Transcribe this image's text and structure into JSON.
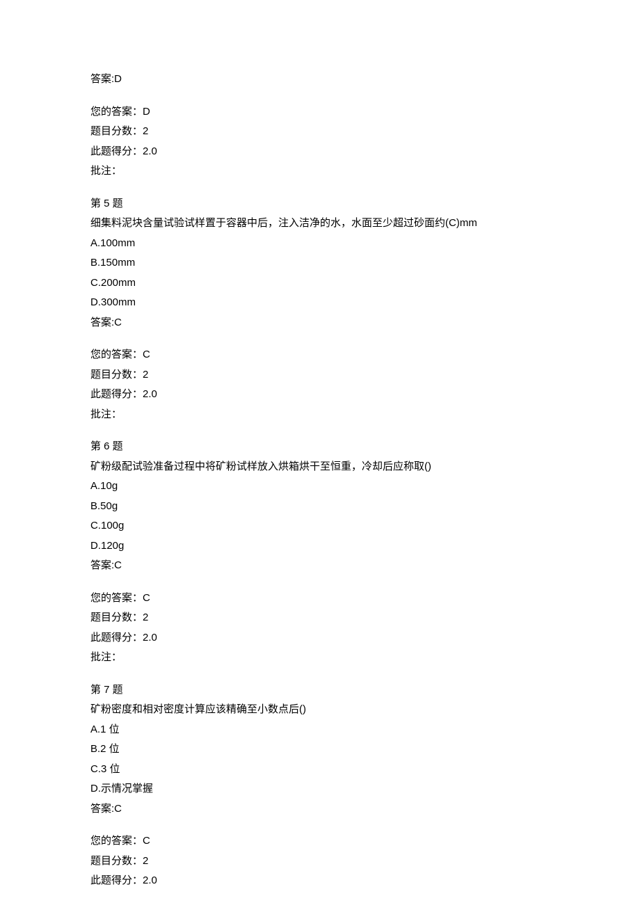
{
  "prev_answer_tail": {
    "answer_label": "答案:D",
    "your_answer_label": "您的答案：D",
    "score_label": "题目分数：2",
    "obtained_label": "此题得分：2.0",
    "remark_label": "批注："
  },
  "questions": [
    {
      "number_label": "第 5 题",
      "stem": "细集料泥块含量试验试样置于容器中后，注入洁净的水，水面至少超过砂面约(C)mm",
      "options": {
        "A": "A.100mm",
        "B": "B.150mm",
        "C": "C.200mm",
        "D": "D.300mm"
      },
      "answer_label": "答案:C",
      "your_answer_label": "您的答案：C",
      "score_label": "题目分数：2",
      "obtained_label": "此题得分：2.0",
      "remark_label": "批注："
    },
    {
      "number_label": "第 6 题",
      "stem": "矿粉级配试验准备过程中将矿粉试样放入烘箱烘干至恒重，冷却后应称取()",
      "options": {
        "A": "A.10g",
        "B": "B.50g",
        "C": "C.100g",
        "D": "D.120g"
      },
      "answer_label": "答案:C",
      "your_answer_label": "您的答案：C",
      "score_label": "题目分数：2",
      "obtained_label": "此题得分：2.0",
      "remark_label": "批注："
    },
    {
      "number_label": "第 7 题",
      "stem": "矿粉密度和相对密度计算应该精确至小数点后()",
      "options": {
        "A": "A.1 位",
        "B": "B.2 位",
        "C": "C.3 位",
        "D": "D.示情况掌握"
      },
      "answer_label": "答案:C",
      "your_answer_label": "您的答案：C",
      "score_label": "题目分数：2",
      "obtained_label": "此题得分：2.0",
      "remark_label": ""
    }
  ]
}
